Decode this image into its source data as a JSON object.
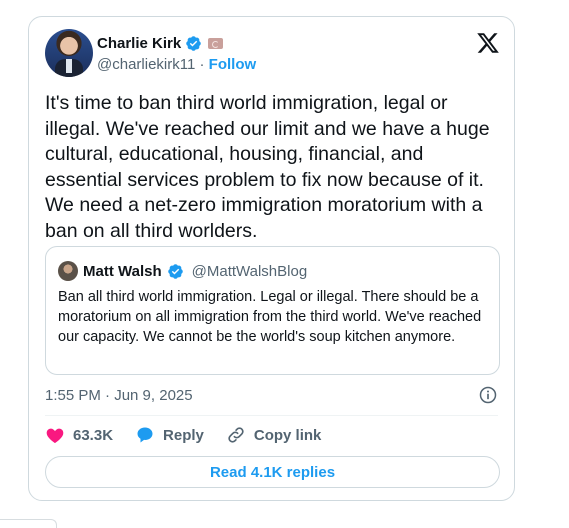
{
  "author": {
    "name": "Charlie Kirk",
    "handle": "@charliekirk11",
    "separator": "·",
    "follow_label": "Follow"
  },
  "tweet": {
    "text": "It's time to ban third world immigration, legal or illegal. We've reached our limit and we have a huge cultural, educational, housing, financial, and essential services problem to fix now because of it. We need a net-zero immigration moratorium with a ban on all third worlders.",
    "timestamp": "1:55 PM · Jun 9, 2025"
  },
  "quoted": {
    "name": "Matt Walsh",
    "handle": "@MattWalshBlog",
    "text": "Ban all third world immigration. Legal or illegal. There should be a moratorium on all immigration from the third world. We've reached our capacity. We cannot be the world's soup kitchen anymore."
  },
  "actions": {
    "likes": "63.3K",
    "reply_label": "Reply",
    "copy_link_label": "Copy link"
  },
  "read_replies_label": "Read 4.1K replies",
  "colors": {
    "accent": "#1d9bf0",
    "like": "#f91880",
    "text": "#0f1419",
    "muted": "#536471",
    "border": "#cfd9de"
  },
  "icons": [
    "x-logo-icon",
    "verified-badge-icon",
    "flag-icon",
    "info-icon",
    "heart-icon",
    "reply-icon",
    "link-icon"
  ]
}
